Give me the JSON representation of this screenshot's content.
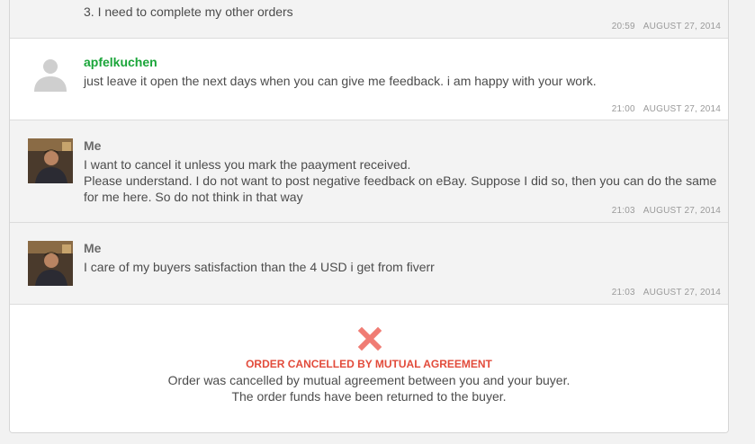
{
  "messages": [
    {
      "partial_line": "3. I need to complete my other orders",
      "time": "20:59",
      "date": "AUGUST 27, 2014"
    },
    {
      "sender": "apfelkuchen",
      "text": "just leave it open the next days when you can give me feedback. i am happy with your work.",
      "time": "21:00",
      "date": "AUGUST 27, 2014"
    },
    {
      "sender": "Me",
      "lines": [
        "I want to cancel it unless you mark the paayment received.",
        "Please understand. I do not want to post negative feedback on eBay. Suppose I did so, then you can do the same for me here. So do not think in that way"
      ],
      "time": "21:03",
      "date": "AUGUST 27, 2014"
    },
    {
      "sender": "Me",
      "text": "I care of my buyers satisfaction than the 4 USD i get from fiverr",
      "time": "21:03",
      "date": "AUGUST 27, 2014"
    }
  ],
  "cancellation": {
    "icon": "close-x-icon",
    "title": "ORDER CANCELLED BY MUTUAL AGREEMENT",
    "line1": "Order was cancelled by mutual agreement between you and your buyer.",
    "line2": "The order funds have been returned to the buyer."
  },
  "colors": {
    "buyer_name": "#1aa539",
    "cancel_title": "#e24b3b",
    "cancel_icon": "#f07c74"
  }
}
